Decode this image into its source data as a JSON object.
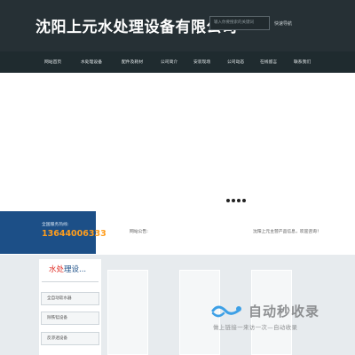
{
  "header": {
    "site_title": "沈阳上元水处理设备有限公司",
    "search_placeholder": "输入你要搜索的关键词",
    "quick_nav": "快速导航"
  },
  "nav": {
    "items": [
      "网站首页",
      "水处理设备",
      "配件及耗材",
      "公司简介",
      "安装现场",
      "公司动态",
      "在线留言",
      "联系我们"
    ]
  },
  "hotline": {
    "label": "全国服务热线:",
    "number": "13644006333"
  },
  "notice": {
    "label": "网站公告:",
    "text": "沈阳上元主营产品信息，欢迎咨询！"
  },
  "side_panel": {
    "title_prefix": "水处",
    "title_suffix": "理设...",
    "items": [
      "全自动软水器",
      "除铁锰设备",
      "反渗透设备"
    ]
  },
  "watermark": {
    "title": "自动秒收录",
    "subtitle": "做上链接一来访一次—自动收录"
  },
  "colors": {
    "header_bg": "#263035",
    "nav_bg": "#1f2b2f",
    "hotline_bg": "#1c4f87",
    "hotline_number": "#ff9d1c",
    "accent_red": "#e0332b"
  }
}
